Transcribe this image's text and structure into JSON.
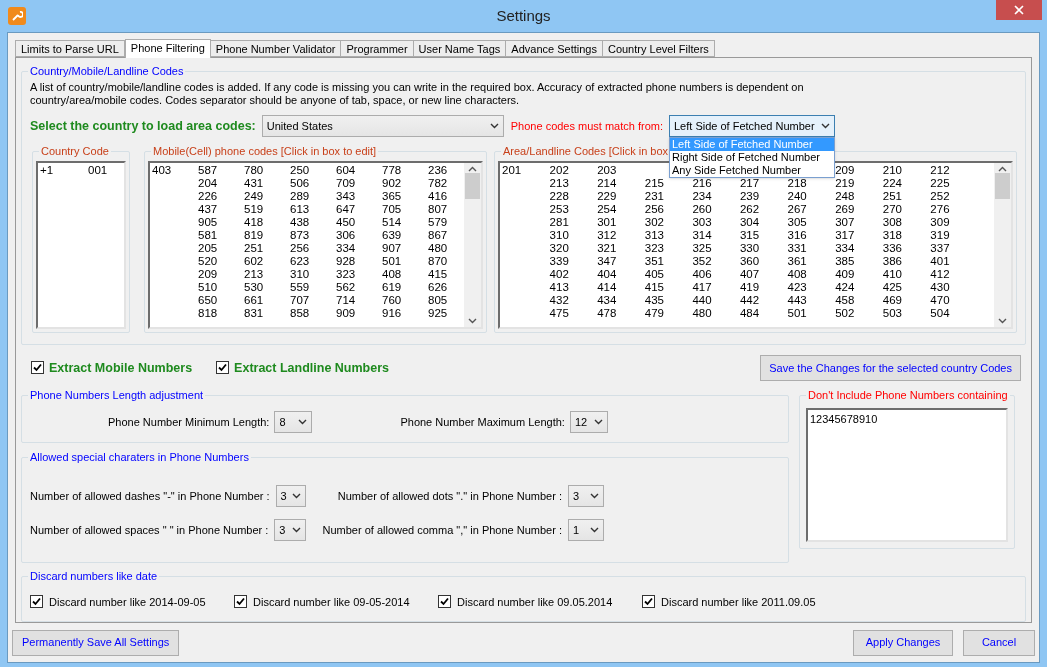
{
  "window": {
    "title": "Settings"
  },
  "tabs": [
    {
      "label": "Limits to Parse URL",
      "selected": false
    },
    {
      "label": "Phone Filtering",
      "selected": true
    },
    {
      "label": "Phone Number Validator",
      "selected": false
    },
    {
      "label": "Programmer",
      "selected": false
    },
    {
      "label": "User Name Tags",
      "selected": false
    },
    {
      "label": "Advance Settings",
      "selected": false
    },
    {
      "label": "Country Level Filters",
      "selected": false
    }
  ],
  "codes_group": {
    "title": "Country/Mobile/Landline Codes",
    "description": "A list of country/mobile/landline codes is added. If any code is missing you can write in the required box. Accuracy of extracted phone numbers is dependent on country/area/mobile codes. Codes separator should be anyone of tab, space, or new line characters.",
    "country_label": "Select the country to load area codes:",
    "country_value": "United States",
    "match_label": "Phone codes must match from:",
    "match_value": "Left Side of Fetched Number",
    "match_options": [
      {
        "label": "Left Side of Fetched Number",
        "selected": true
      },
      {
        "label": "Right Side of Fetched Number",
        "selected": false
      },
      {
        "label": "Any Side Fetched Number",
        "selected": false
      }
    ]
  },
  "country_code": {
    "title": "Country Code",
    "rows": [
      [
        "+1",
        "001"
      ]
    ]
  },
  "mobile_codes": {
    "title": "Mobile(Cell) phone codes  [Click in box to edit]",
    "rows": [
      [
        "403",
        "587",
        "780",
        "250",
        "604",
        "778",
        "236"
      ],
      [
        null,
        "204",
        "431",
        "506",
        "709",
        "902",
        "782"
      ],
      [
        null,
        "226",
        "249",
        "289",
        "343",
        "365",
        "416"
      ],
      [
        null,
        "437",
        "519",
        "613",
        "647",
        "705",
        "807"
      ],
      [
        null,
        "905",
        "418",
        "438",
        "450",
        "514",
        "579"
      ],
      [
        null,
        "581",
        "819",
        "873",
        "306",
        "639",
        "867"
      ],
      [
        null,
        "205",
        "251",
        "256",
        "334",
        "907",
        "480"
      ],
      [
        null,
        "520",
        "602",
        "623",
        "928",
        "501",
        "870"
      ],
      [
        null,
        "209",
        "213",
        "310",
        "323",
        "408",
        "415"
      ],
      [
        null,
        "510",
        "530",
        "559",
        "562",
        "619",
        "626"
      ],
      [
        null,
        "650",
        "661",
        "707",
        "714",
        "760",
        "805"
      ],
      [
        null,
        "818",
        "831",
        "858",
        "909",
        "916",
        "925"
      ]
    ]
  },
  "area_codes": {
    "title": "Area/Landline Codes [Click in box",
    "rows": [
      [
        "201",
        "202",
        "203",
        null,
        null,
        null,
        null,
        "209",
        "210",
        "212"
      ],
      [
        null,
        "213",
        "214",
        "215",
        "216",
        "217",
        "218",
        "219",
        "224",
        "225"
      ],
      [
        null,
        "228",
        "229",
        "231",
        "234",
        "239",
        "240",
        "248",
        "251",
        "252"
      ],
      [
        null,
        "253",
        "254",
        "256",
        "260",
        "262",
        "267",
        "269",
        "270",
        "276"
      ],
      [
        null,
        "281",
        "301",
        "302",
        "303",
        "304",
        "305",
        "307",
        "308",
        "309"
      ],
      [
        null,
        "310",
        "312",
        "313",
        "314",
        "315",
        "316",
        "317",
        "318",
        "319"
      ],
      [
        null,
        "320",
        "321",
        "323",
        "325",
        "330",
        "331",
        "334",
        "336",
        "337"
      ],
      [
        null,
        "339",
        "347",
        "351",
        "352",
        "360",
        "361",
        "385",
        "386",
        "401"
      ],
      [
        null,
        "402",
        "404",
        "405",
        "406",
        "407",
        "408",
        "409",
        "410",
        "412"
      ],
      [
        null,
        "413",
        "414",
        "415",
        "417",
        "419",
        "423",
        "424",
        "425",
        "430"
      ],
      [
        null,
        "432",
        "434",
        "435",
        "440",
        "442",
        "443",
        "458",
        "469",
        "470"
      ],
      [
        null,
        "475",
        "478",
        "479",
        "480",
        "484",
        "501",
        "502",
        "503",
        "504"
      ]
    ]
  },
  "extract_options": [
    {
      "label": "Extract Mobile Numbers",
      "checked": true
    },
    {
      "label": "Extract Landline Numbers",
      "checked": true
    }
  ],
  "save_codes_button": "Save the Changes for the selected country Codes",
  "length_group": {
    "title": "Phone Numbers Length adjustment",
    "fields": [
      {
        "label": "Phone Number Minimum Length:",
        "value": "8"
      },
      {
        "label": "Phone Number Maximum Length:",
        "value": "12"
      }
    ]
  },
  "special_group": {
    "title": "Allowed special charaters in Phone Numbers",
    "fields": [
      {
        "label": "Number of allowed dashes \"-\" in Phone Number :",
        "value": "3"
      },
      {
        "label": "Number of allowed dots \".\" in Phone Number :",
        "value": "3"
      },
      {
        "label": "Number of allowed spaces \" \" in Phone Number :",
        "value": "3"
      },
      {
        "label": "Number of allowed  comma \",\" in Phone Number :",
        "value": "1"
      }
    ]
  },
  "exclude_group": {
    "title": "Don't Include Phone Numbers containing",
    "value": "12345678910"
  },
  "date_group": {
    "title": "Discard numbers like date",
    "options": [
      {
        "label": "Discard number like 2014-09-05",
        "checked": true
      },
      {
        "label": "Discard number like 09-05-2014",
        "checked": true
      },
      {
        "label": "Discard number like 09.05.2014",
        "checked": true
      },
      {
        "label": "Discard number like 2011.09.05",
        "checked": true
      }
    ]
  },
  "buttons": {
    "save_all": "Permanently Save All Settings",
    "apply": "Apply Changes",
    "cancel": "Cancel"
  }
}
